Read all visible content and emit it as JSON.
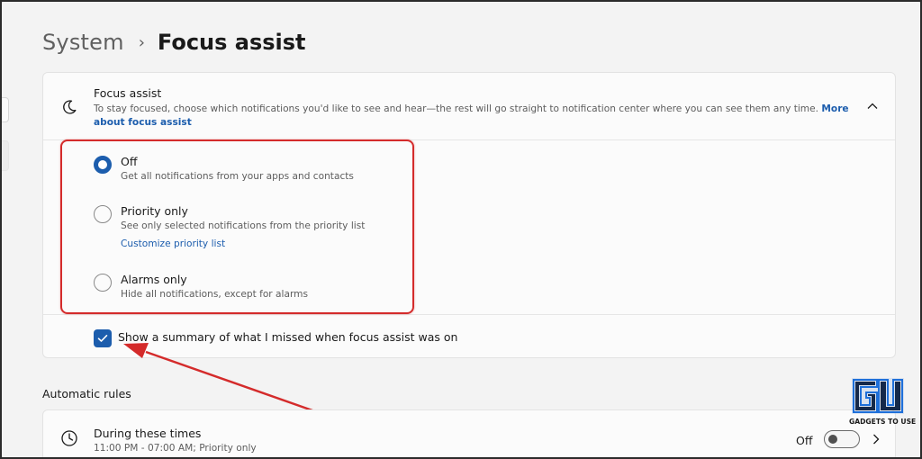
{
  "breadcrumb": {
    "parent": "System",
    "separator": "›",
    "current": "Focus assist"
  },
  "focus_card": {
    "icon": "moon-icon",
    "title": "Focus assist",
    "description": "To stay focused, choose which notifications you'd like to see and hear—the rest will go straight to notification center where you can see them any time. ",
    "link_text": "More about focus assist",
    "collapse_icon": "chevron-up-icon",
    "options": [
      {
        "title": "Off",
        "description": "Get all notifications from your apps and contacts",
        "selected": true
      },
      {
        "title": "Priority only",
        "description": "See only selected notifications from the priority list",
        "link": "Customize priority list",
        "selected": false
      },
      {
        "title": "Alarms only",
        "description": "Hide all notifications, except for alarms",
        "selected": false
      }
    ],
    "summary_checkbox": {
      "label": "Show a summary of what I missed when focus assist was on",
      "checked": true
    }
  },
  "automatic_rules": {
    "title": "Automatic rules",
    "rules": [
      {
        "icon": "clock-icon",
        "title": "During these times",
        "description": "11:00 PM - 07:00 AM; Priority only",
        "toggle_label": "Off",
        "toggle_on": false
      }
    ]
  },
  "colors": {
    "accent": "#1c5dad",
    "annotation": "#d42b2b",
    "background": "#f3f3f3",
    "card": "#fbfbfb"
  },
  "watermark": {
    "logo_text": "GADGETS TO USE"
  }
}
